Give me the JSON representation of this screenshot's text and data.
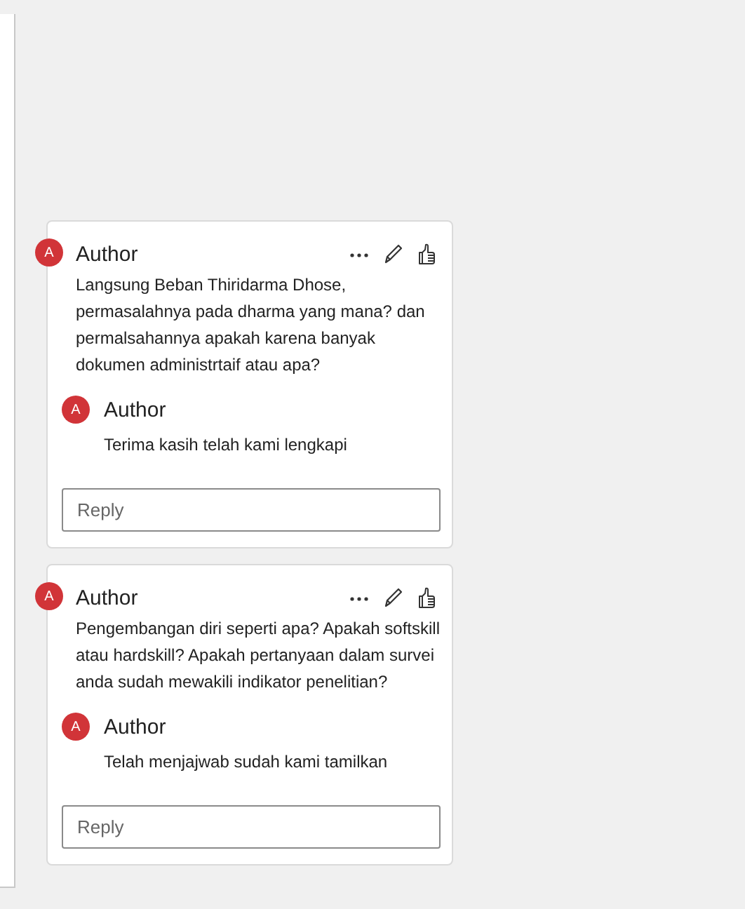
{
  "threads": [
    {
      "author": {
        "initial": "A",
        "name": "Author"
      },
      "text": "Langsung Beban Thiridarma Dhose, permasalahnya pada dharma yang mana? dan permalsahannya apakah karena banyak dokumen administrtaif atau apa?",
      "reply": {
        "author": {
          "initial": "A",
          "name": "Author"
        },
        "text": "Terima kasih telah kami lengkapi"
      },
      "reply_field": {
        "placeholder": "Reply"
      }
    },
    {
      "author": {
        "initial": "A",
        "name": "Author"
      },
      "text": "Pengembangan diri seperti apa? Apakah softskill atau hardskill? Apakah pertanyaan dalam survei anda sudah mewakili indikator penelitian?",
      "reply": {
        "author": {
          "initial": "A",
          "name": "Author"
        },
        "text": "Telah menjajwab sudah kami tamilkan"
      },
      "reply_field": {
        "placeholder": "Reply"
      }
    }
  ]
}
